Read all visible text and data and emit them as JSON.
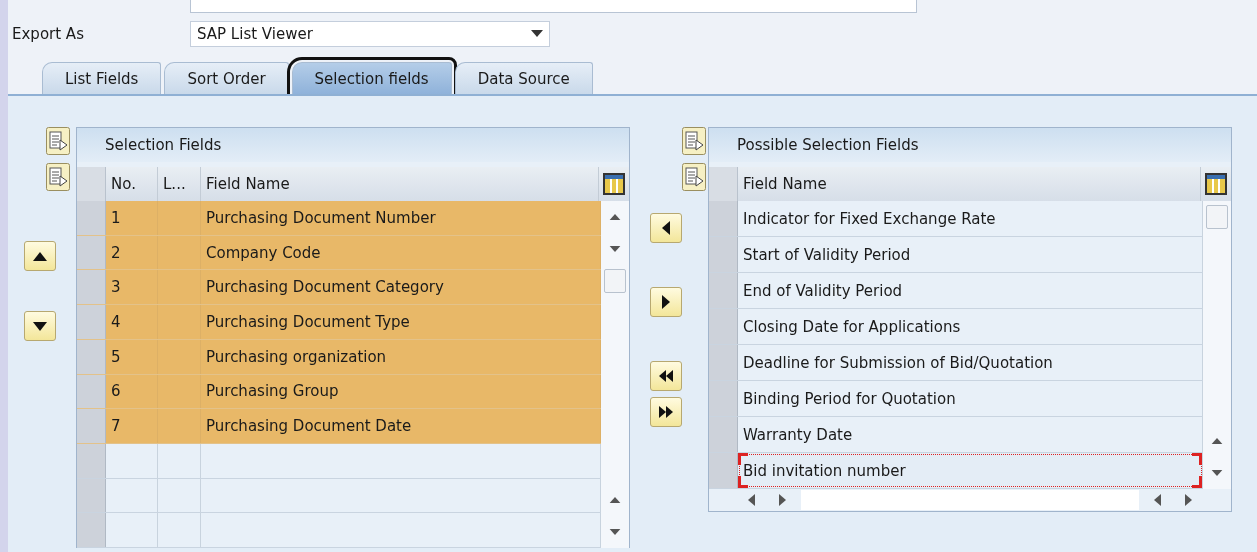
{
  "export_as": {
    "label": "Export As",
    "value": "SAP List Viewer"
  },
  "tabs": [
    {
      "label": "List Fields",
      "selected": false,
      "highlighted": false
    },
    {
      "label": "Sort Order",
      "selected": false,
      "highlighted": false
    },
    {
      "label": "Selection fields",
      "selected": true,
      "highlighted": true
    },
    {
      "label": "Data Source",
      "selected": false,
      "highlighted": false
    }
  ],
  "selection_fields": {
    "title": "Selection Fields",
    "columns": [
      "No.",
      "L...",
      "Field Name"
    ],
    "rows": [
      {
        "no": "1",
        "field_name": "Purchasing Document Number",
        "selected": true
      },
      {
        "no": "2",
        "field_name": "Company Code",
        "selected": true
      },
      {
        "no": "3",
        "field_name": "Purchasing Document Category",
        "selected": true
      },
      {
        "no": "4",
        "field_name": "Purchasing Document Type",
        "selected": true
      },
      {
        "no": "5",
        "field_name": "Purchasing organization",
        "selected": true
      },
      {
        "no": "6",
        "field_name": "Purchasing Group",
        "selected": true
      },
      {
        "no": "7",
        "field_name": "Purchasing Document Date",
        "selected": true
      }
    ]
  },
  "possible_selection_fields": {
    "title": "Possible Selection Fields",
    "columns": [
      "Field Name"
    ],
    "rows": [
      {
        "field_name": "Indicator for Fixed Exchange Rate",
        "focused": false
      },
      {
        "field_name": "Start of Validity Period",
        "focused": false
      },
      {
        "field_name": "End of Validity Period",
        "focused": false
      },
      {
        "field_name": "Closing Date for Applications",
        "focused": false
      },
      {
        "field_name": "Deadline for Submission of Bid/Quotation",
        "focused": false
      },
      {
        "field_name": "Binding Period for Quotation",
        "focused": false
      },
      {
        "field_name": "Warranty Date",
        "focused": false
      },
      {
        "field_name": "Bid invitation number",
        "focused": true
      }
    ]
  }
}
